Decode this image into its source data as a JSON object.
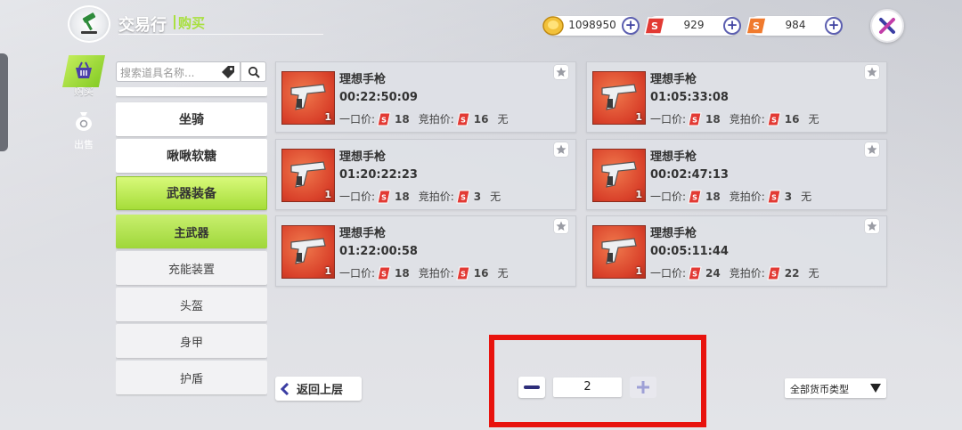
{
  "header": {
    "title": "交易行",
    "subtitle": "购买"
  },
  "currencies": [
    {
      "name": "gold-coin",
      "value": "1098950",
      "color": "#f2c13a"
    },
    {
      "name": "red-ticket",
      "value": "929",
      "color": "#e23a34"
    },
    {
      "name": "orange-ticket",
      "value": "984",
      "color": "#f07a2e"
    }
  ],
  "nav": {
    "buy_label": "购买",
    "sell_label": "出售"
  },
  "search": {
    "placeholder": "搜索道具名称..."
  },
  "categories": {
    "items": [
      {
        "label": "坐骑"
      },
      {
        "label": "啾啾软糖"
      },
      {
        "label": "武器装备"
      }
    ],
    "subitems": [
      {
        "label": "主武器"
      },
      {
        "label": "充能装置"
      },
      {
        "label": "头盔"
      },
      {
        "label": "身甲"
      },
      {
        "label": "护盾"
      }
    ]
  },
  "listings": [
    {
      "name": "理想手枪",
      "time": "00:22:50:09",
      "qty": "1",
      "buyout_label": "一口价:",
      "buyout": "18",
      "bid_label": "竞拍价:",
      "bid": "16",
      "none": "无"
    },
    {
      "name": "理想手枪",
      "time": "01:05:33:08",
      "qty": "1",
      "buyout_label": "一口价:",
      "buyout": "18",
      "bid_label": "竞拍价:",
      "bid": "16",
      "none": "无"
    },
    {
      "name": "理想手枪",
      "time": "01:20:22:23",
      "qty": "1",
      "buyout_label": "一口价:",
      "buyout": "18",
      "bid_label": "竞拍价:",
      "bid": "3",
      "none": "无"
    },
    {
      "name": "理想手枪",
      "time": "00:02:47:13",
      "qty": "1",
      "buyout_label": "一口价:",
      "buyout": "18",
      "bid_label": "竞拍价:",
      "bid": "3",
      "none": "无"
    },
    {
      "name": "理想手枪",
      "time": "01:22:00:58",
      "qty": "1",
      "buyout_label": "一口价:",
      "buyout": "18",
      "bid_label": "竞拍价:",
      "bid": "16",
      "none": "无"
    },
    {
      "name": "理想手枪",
      "time": "00:05:11:44",
      "qty": "1",
      "buyout_label": "一口价:",
      "buyout": "24",
      "bid_label": "竞拍价:",
      "bid": "22",
      "none": "无"
    }
  ],
  "footer": {
    "back_label": "返回上层",
    "page": "2",
    "currency_filter": "全部货币类型"
  },
  "colors": {
    "accent_green": "#a6dd3a",
    "highlight_red": "#e8130e",
    "button_purple": "#4b4ea8"
  }
}
